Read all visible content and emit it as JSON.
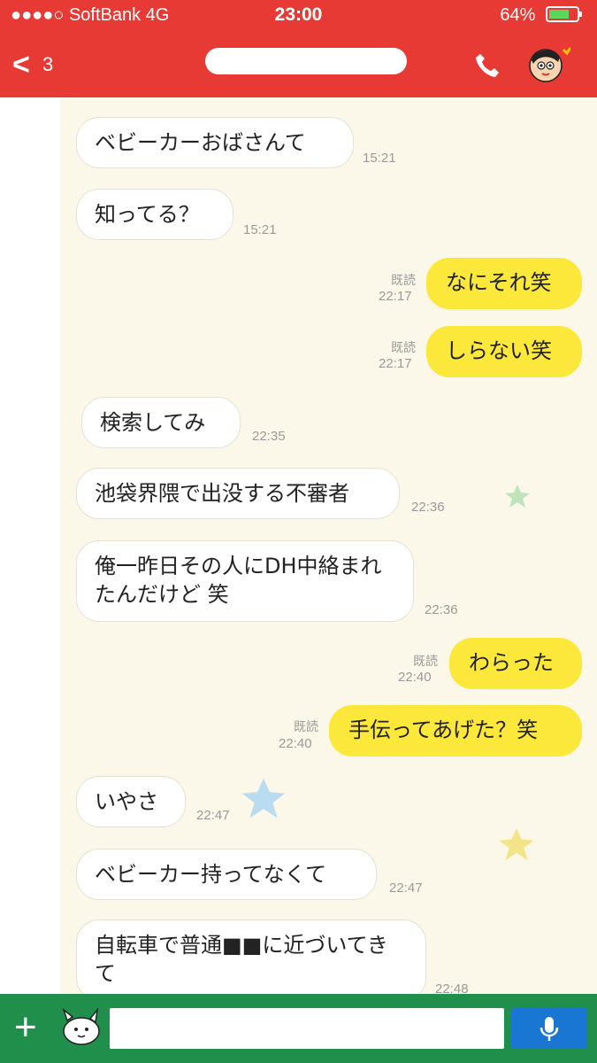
{
  "status": {
    "carrier": "●●●●○ SoftBank  4G",
    "time": "23:00",
    "battery": "64%"
  },
  "header": {
    "back_count": "3"
  },
  "messages": [
    {
      "side": "in",
      "text": "ベビーカーおばさんて",
      "time": "15:21"
    },
    {
      "side": "in",
      "text": "知ってる？",
      "time": "15:21"
    },
    {
      "side": "out",
      "text": "なにそれ笑",
      "read": "既読",
      "time": "22:17"
    },
    {
      "side": "out",
      "text": "しらない笑",
      "read": "既読",
      "time": "22:17"
    },
    {
      "side": "in",
      "text": "検索してみ",
      "time": "22:35"
    },
    {
      "side": "in",
      "text": "池袋界隈で出没する不審者",
      "time": "22:36"
    },
    {
      "side": "in",
      "text": "俺一昨日その人にDH中絡まれたんだけど 笑",
      "time": "22:36"
    },
    {
      "side": "out",
      "text": "わらった",
      "read": "既読",
      "time": "22:40"
    },
    {
      "side": "out",
      "text": "手伝ってあげた？笑",
      "read": "既読",
      "time": "22:40"
    },
    {
      "side": "in",
      "text": "いやさ",
      "time": "22:47"
    },
    {
      "side": "in",
      "text": "ベビーカー持ってなくて",
      "time": "22:47"
    },
    {
      "side": "in",
      "text": "自転車で普通■■に近づいてきて",
      "time": "22:48"
    }
  ],
  "footer": {
    "input_value": ""
  },
  "colors": {
    "header_bg": "#e83a35",
    "footer_bg": "#1f8f4b",
    "own_bubble": "#fbe83a",
    "mic_bg": "#1976d2"
  },
  "icons": [
    "back-chevron-icon",
    "phone-icon",
    "profile-avatar-icon",
    "plus-icon",
    "sticker-icon",
    "mic-icon",
    "star-decoration-icon"
  ]
}
